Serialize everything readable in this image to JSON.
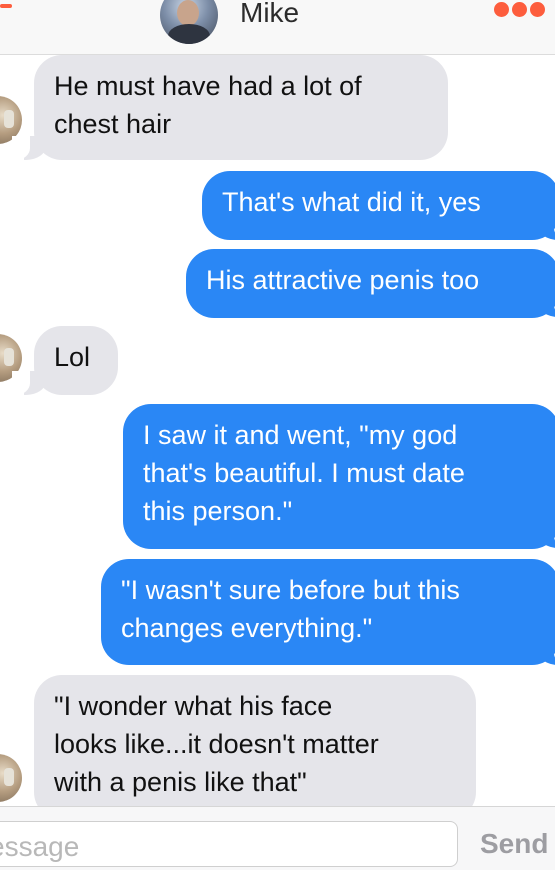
{
  "header": {
    "contact_name": "Mike",
    "menu_icon": "more-dots-icon",
    "accent_color": "#fd5d3d"
  },
  "messages": [
    {
      "direction": "incoming",
      "text": "He must have had a lot of\nchest hair"
    },
    {
      "direction": "outgoing",
      "text": "That's what did it, yes"
    },
    {
      "direction": "outgoing",
      "text": "His attractive penis too"
    },
    {
      "direction": "incoming",
      "text": "Lol"
    },
    {
      "direction": "outgoing",
      "text": "I saw it and went, \"my god\nthat's beautiful. I must date\nthis person.\""
    },
    {
      "direction": "outgoing",
      "text": "\"I wasn't sure before but this\nchanges everything.\""
    },
    {
      "direction": "incoming",
      "text": "\"I wonder what his face\nlooks like...it doesn't matter\nwith a penis like that\""
    }
  ],
  "composer": {
    "placeholder": "essage",
    "send_label": "Send"
  },
  "colors": {
    "outgoing_bubble": "#2a87f5",
    "incoming_bubble": "#e5e5ea"
  }
}
